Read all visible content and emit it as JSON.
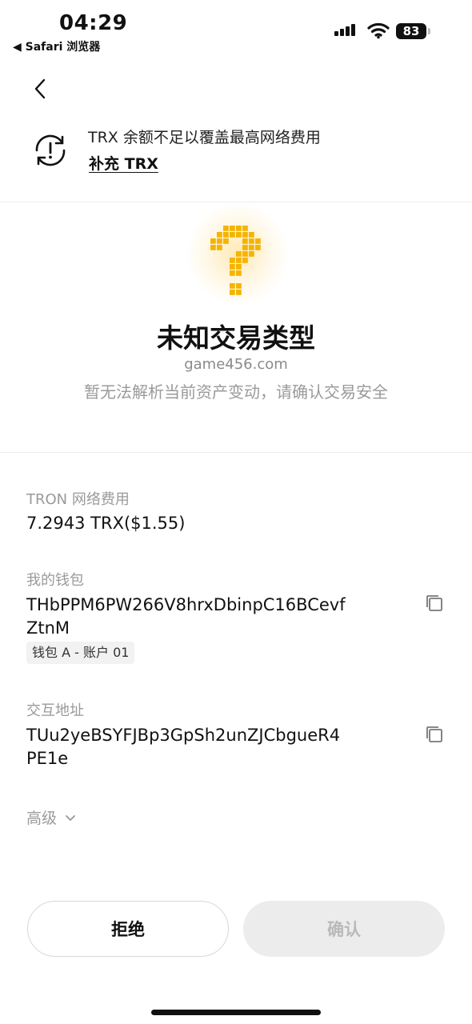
{
  "status_bar": {
    "time": "04:29",
    "back_app": "◀ Safari 浏览器",
    "battery": "83"
  },
  "warning": {
    "text": "TRX 余额不足以覆盖最高网络费用",
    "link": "补充 TRX"
  },
  "transaction": {
    "title": "未知交易类型",
    "domain": "game456.com",
    "subtitle": "暂无法解析当前资产变动，请确认交易安全"
  },
  "fee": {
    "label": "TRON 网络费用",
    "value": "7.2943 TRX($1.55)"
  },
  "my_wallet": {
    "label": "我的钱包",
    "address": "THbPPM6PW266V8hrxDbinpC16BCevfZtnM",
    "account": "钱包 A - 账户 01"
  },
  "interact": {
    "label": "交互地址",
    "address": "TUu2yeBSYFJBp3GpSh2unZJCbgueR4PE1e"
  },
  "advanced": {
    "label": "高级"
  },
  "buttons": {
    "reject": "拒绝",
    "confirm": "确认"
  },
  "colors": {
    "accent_yellow": "#F5B400",
    "disabled_bg": "#ECECEC",
    "muted_text": "#9A9A9A"
  },
  "icons": [
    "cellular-signal-icon",
    "wifi-icon",
    "battery-icon",
    "back-arrow-icon",
    "refresh-warning-icon",
    "question-mark-pixel-icon",
    "copy-icon",
    "chevron-down-icon"
  ]
}
